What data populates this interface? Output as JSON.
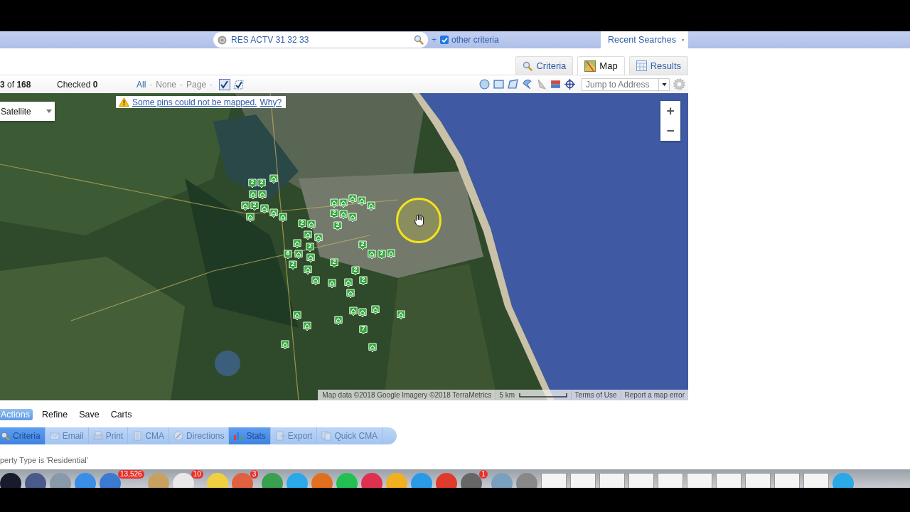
{
  "search": {
    "query": "RES ACTV 31 32 33",
    "add": "+",
    "other_criteria": {
      "label": "other criteria",
      "checked": true
    }
  },
  "recent_searches": "Recent Searches",
  "tabs": [
    {
      "label": "Criteria",
      "selected": false
    },
    {
      "label": "Map",
      "selected": true
    },
    {
      "label": "Results",
      "selected": false
    }
  ],
  "toolbar": {
    "count": "**3** of **168**",
    "checked": "Checked **0**",
    "select_links": [
      {
        "label": "All",
        "selected": true,
        "sep": "·"
      },
      {
        "label": "None",
        "selected": false,
        "sep": "·"
      },
      {
        "label": "Page",
        "selected": false,
        "sep": "·"
      }
    ],
    "jump_placeholder": "Jump to Address"
  },
  "map": {
    "type_control": "Satellite",
    "notice": "Some pins could not be mapped.",
    "notice_link": "Why?",
    "zoom_in": "+",
    "zoom_out": "−",
    "attribution": "Map data ©2018 Google Imagery ©2018 TerraMetrics",
    "scale": "5 km",
    "terms": "Terms of Use",
    "report": "Report a map error",
    "pins": [
      {
        "kind": "count",
        "label": "2"
      },
      {
        "kind": "count",
        "label": "2"
      },
      {
        "kind": "house"
      },
      {
        "kind": "house"
      },
      {
        "kind": "house"
      },
      {
        "kind": "house"
      },
      {
        "kind": "count",
        "label": "2"
      },
      {
        "kind": "house"
      },
      {
        "kind": "house"
      },
      {
        "kind": "house"
      },
      {
        "kind": "house"
      },
      {
        "kind": "house"
      },
      {
        "kind": "house"
      },
      {
        "kind": "house"
      },
      {
        "kind": "house"
      },
      {
        "kind": "house"
      },
      {
        "kind": "count",
        "label": "2"
      },
      {
        "kind": "house"
      },
      {
        "kind": "house"
      },
      {
        "kind": "count",
        "label": "2"
      },
      {
        "kind": "count",
        "label": "2"
      },
      {
        "kind": "house"
      },
      {
        "kind": "house"
      },
      {
        "kind": "house"
      },
      {
        "kind": "house"
      },
      {
        "kind": "count",
        "label": "2"
      },
      {
        "kind": "count",
        "label": "6"
      },
      {
        "kind": "house"
      },
      {
        "kind": "count",
        "label": "2"
      },
      {
        "kind": "house"
      },
      {
        "kind": "house"
      },
      {
        "kind": "count",
        "label": "2"
      },
      {
        "kind": "count",
        "label": "2"
      },
      {
        "kind": "house"
      },
      {
        "kind": "count",
        "label": "2"
      },
      {
        "kind": "house"
      },
      {
        "kind": "count",
        "label": "2"
      },
      {
        "kind": "count",
        "label": "2"
      },
      {
        "kind": "house"
      },
      {
        "kind": "house"
      },
      {
        "kind": "house"
      },
      {
        "kind": "house"
      },
      {
        "kind": "house"
      },
      {
        "kind": "house"
      },
      {
        "kind": "house"
      },
      {
        "kind": "house"
      },
      {
        "kind": "house"
      },
      {
        "kind": "house"
      },
      {
        "kind": "house"
      },
      {
        "kind": "count",
        "label": "7"
      },
      {
        "kind": "house"
      },
      {
        "kind": "house"
      }
    ]
  },
  "menu": [
    {
      "label": "Actions",
      "selected": true
    },
    {
      "label": "Refine",
      "selected": false
    },
    {
      "label": "Save",
      "selected": false
    },
    {
      "label": "Carts",
      "selected": false
    }
  ],
  "action_buttons": [
    {
      "label": "Criteria",
      "selected": true,
      "disabled": false
    },
    {
      "label": "Email",
      "selected": false,
      "disabled": true
    },
    {
      "label": "Print",
      "selected": false,
      "disabled": true
    },
    {
      "label": "CMA",
      "selected": false,
      "disabled": true
    },
    {
      "label": "Directions",
      "selected": false,
      "disabled": true
    },
    {
      "label": "Stats",
      "selected": true,
      "disabled": false
    },
    {
      "label": "Export",
      "selected": false,
      "disabled": true
    },
    {
      "label": "Quick CMA",
      "selected": false,
      "disabled": true
    }
  ],
  "criteria_summary": "perty Type is 'Residential'",
  "dock": [
    {
      "kind": "app"
    },
    {
      "kind": "app"
    },
    {
      "kind": "app"
    },
    {
      "kind": "app"
    },
    {
      "kind": "app",
      "badge": "13,526"
    },
    {
      "kind": "app"
    },
    {
      "kind": "app",
      "badge": "10"
    },
    {
      "kind": "app"
    },
    {
      "kind": "app",
      "badge": "3"
    },
    {
      "kind": "app"
    },
    {
      "kind": "app"
    },
    {
      "kind": "app"
    },
    {
      "kind": "app"
    },
    {
      "kind": "app"
    },
    {
      "kind": "app"
    },
    {
      "kind": "app"
    },
    {
      "kind": "app"
    },
    {
      "kind": "app",
      "badge": "1"
    },
    {
      "kind": "app"
    },
    {
      "kind": "app"
    },
    {
      "kind": "window"
    },
    {
      "kind": "window"
    },
    {
      "kind": "window"
    },
    {
      "kind": "window"
    },
    {
      "kind": "window"
    },
    {
      "kind": "window"
    },
    {
      "kind": "window"
    },
    {
      "kind": "window"
    },
    {
      "kind": "window"
    },
    {
      "kind": "window"
    },
    {
      "kind": "app"
    }
  ]
}
